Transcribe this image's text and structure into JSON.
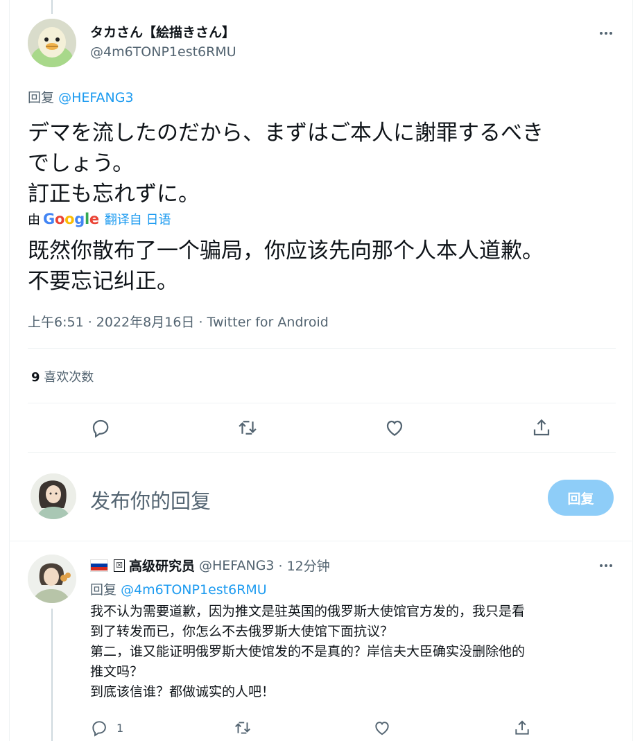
{
  "main_tweet": {
    "author_name": "タカさん【絵描きさん】",
    "handle": "@4m6TONP1est6RMU",
    "reply_to_label": "回复",
    "reply_to_handle": "@HEFANG3",
    "text_lines": [
      "デマを流したのだから、まずはご本人に謝罪するべき",
      "でしょう。",
      "訂正も忘れずに。"
    ],
    "translate_prefix": "由",
    "translate_logo": {
      "G": "G",
      "o1": "o",
      "o2": "o",
      "g": "g",
      "l": "l",
      "e": "e"
    },
    "translate_link": "翻译自 日语",
    "translated_lines": [
      "既然你散布了一个骗局，你应该先向那个人本人道歉。",
      "不要忘记纠正。"
    ],
    "timestamp": "上午6:51 · 2022年8月16日 · Twitter for Android",
    "likes_count": "9",
    "likes_label": "喜欢次数"
  },
  "composer": {
    "placeholder": "发布你的回复",
    "button_label": "回复"
  },
  "reply_tweet": {
    "author_name": "高级研究员",
    "badge": "☒",
    "handle": "@HEFANG3",
    "time_ago": "· 12分钟",
    "reply_to_label": "回复",
    "reply_to_handle": "@4m6TONP1est6RMU",
    "body_lines": [
      "我不认为需要道歉，因为推文是驻英国的俄罗斯大使馆官方发的，我只是看",
      "到了转发而已，你怎么不去俄罗斯大使馆下面抗议？",
      "第二，谁又能证明俄罗斯大使馆发的不是真的？岸信夫大臣确实没删除他的",
      "推文吗？",
      "到底该信谁？都做诚实的人吧！"
    ],
    "reply_count": "1"
  },
  "colors": {
    "accent": "#1d9bf0",
    "muted": "#536471",
    "button_disabled": "#8ecdf8"
  },
  "icons": [
    "more-icon",
    "reply-icon",
    "retweet-icon",
    "like-icon",
    "share-icon"
  ]
}
